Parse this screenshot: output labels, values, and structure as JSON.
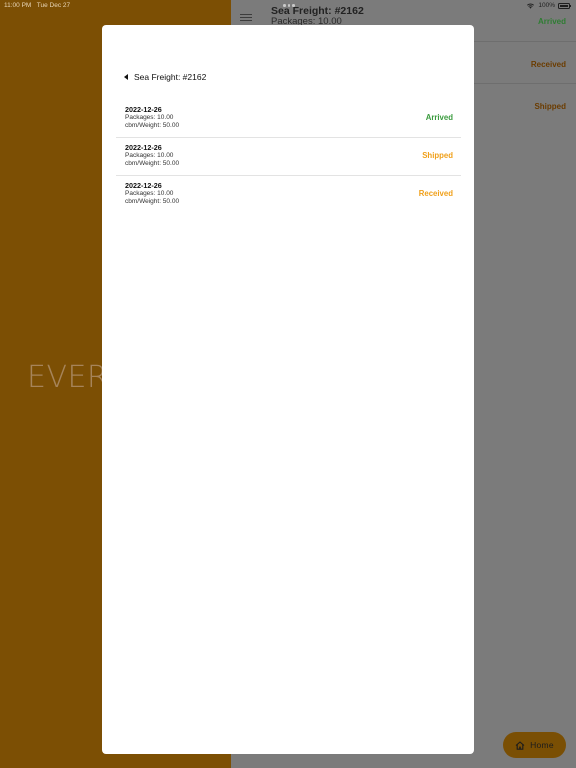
{
  "status_bar": {
    "time": "11:00 PM",
    "date": "Tue Dec 27",
    "battery": "100%"
  },
  "brand": "EVER",
  "background_list": {
    "title": "Sea Freight: #2162",
    "subtitle": "Packages: 10.00",
    "statuses": [
      {
        "label": "Arrived",
        "color": "#2e7d32"
      },
      {
        "label": "Received",
        "color": "#6b3c00"
      },
      {
        "label": "Shipped",
        "color": "#6b3c00"
      }
    ]
  },
  "modal": {
    "title": "Sea Freight: #2162",
    "rows": [
      {
        "date": "2022-12-26",
        "packages": "Packages: 10.00",
        "cbm": "cbm/Weight: 50.00",
        "status": "Arrived",
        "status_color": "#3a9b3e"
      },
      {
        "date": "2022-12-26",
        "packages": "Packages: 10.00",
        "cbm": "cbm/Weight: 50.00",
        "status": "Shipped",
        "status_color": "#f0a01a"
      },
      {
        "date": "2022-12-26",
        "packages": "Packages: 10.00",
        "cbm": "cbm/Weight: 50.00",
        "status": "Received",
        "status_color": "#f0a01a"
      }
    ]
  },
  "home_button": {
    "label": "Home",
    "icon": "home-icon"
  }
}
